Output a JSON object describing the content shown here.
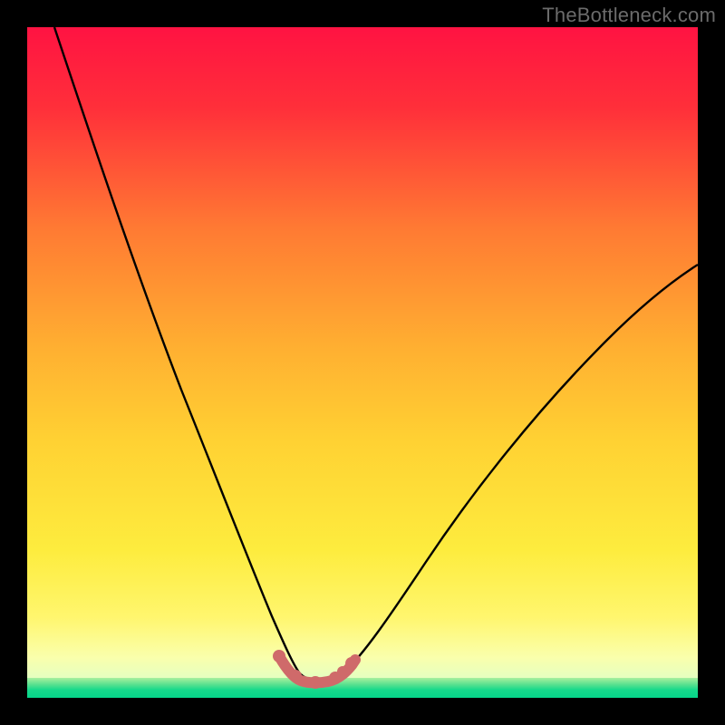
{
  "watermark": "TheBottleneck.com",
  "colors": {
    "background": "#000000",
    "gradient_top": "#ff1a3d",
    "gradient_mid1": "#ff7a33",
    "gradient_mid2": "#ffd233",
    "gradient_mid3": "#fff04a",
    "gradient_bottom_pale": "#f7ffb0",
    "green_band_start": "#a8f09e",
    "green_band_end": "#06d58a",
    "curve": "#000000",
    "highlight": "#cf6a6a"
  },
  "chart_data": {
    "type": "line",
    "title": "",
    "xlabel": "",
    "ylabel": "",
    "xlim": [
      0,
      100
    ],
    "ylim": [
      0,
      100
    ],
    "series": [
      {
        "name": "bottleneck-curve",
        "x": [
          0,
          6,
          12,
          18,
          24,
          30,
          34,
          38,
          40,
          42,
          44,
          48,
          55,
          62,
          70,
          80,
          90,
          100
        ],
        "y": [
          100,
          85,
          70,
          55,
          40,
          25,
          14,
          5,
          3,
          2,
          3,
          6,
          14,
          23,
          33,
          44,
          53,
          60
        ]
      }
    ],
    "highlight_segment": {
      "x_start": 37,
      "x_end": 47,
      "description": "flattened valley bottom with dot markers"
    },
    "color_scale": {
      "description": "vertical gradient red (high bottleneck) → green (optimal) mapped to y-axis",
      "stops": [
        {
          "pct": 0,
          "color": "#ff1a3d"
        },
        {
          "pct": 33,
          "color": "#ff7a33"
        },
        {
          "pct": 55,
          "color": "#ffd233"
        },
        {
          "pct": 80,
          "color": "#fff04a"
        },
        {
          "pct": 93,
          "color": "#f7ffb0"
        },
        {
          "pct": 100,
          "color": "#06d58a"
        }
      ]
    }
  }
}
